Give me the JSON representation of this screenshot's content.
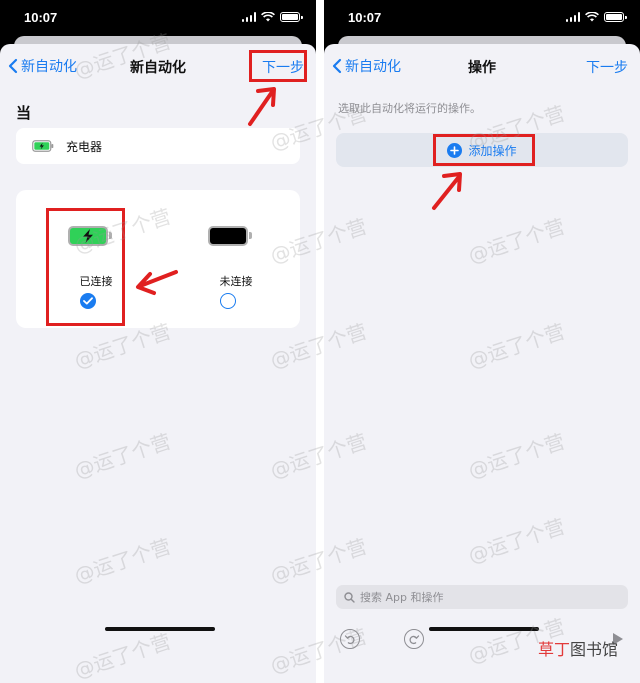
{
  "left_screen": {
    "status": {
      "time": "10:07"
    },
    "nav": {
      "back_label": "新自动化",
      "title": "新自动化",
      "next_label": "下一步"
    },
    "section_heading": "当",
    "trigger": {
      "label": "充电器",
      "icon": "charging-battery-icon"
    },
    "options": [
      {
        "label": "已连接",
        "selected": true,
        "icon": "battery-charging-icon"
      },
      {
        "label": "未连接",
        "selected": false,
        "icon": "battery-icon"
      }
    ]
  },
  "right_screen": {
    "status": {
      "time": "10:07"
    },
    "nav": {
      "back_label": "新自动化",
      "title": "操作",
      "next_label": "下一步"
    },
    "hint": "选取此自动化将运行的操作。",
    "add_action_label": "添加操作",
    "search": {
      "placeholder": "搜索 App 和操作"
    },
    "toolbar": {
      "undo_icon": "undo-icon",
      "redo_icon": "redo-icon",
      "play_icon": "play-icon"
    }
  },
  "watermark_text": "@运了个营",
  "brand": {
    "part1": "草丁",
    "part2": "图书馆"
  },
  "colors": {
    "accent": "#1a7cf0",
    "highlight": "#e02020",
    "charge_green": "#30d158",
    "sheet_bg": "#f2f2f7"
  }
}
